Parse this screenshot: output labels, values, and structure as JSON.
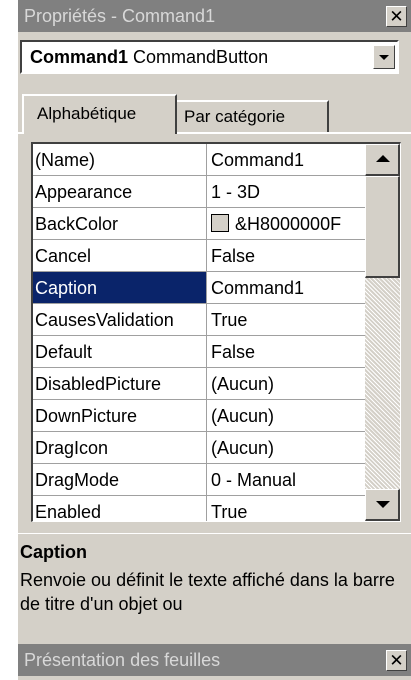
{
  "window": {
    "title": "Propriétés - Command1",
    "close_glyph": "✕"
  },
  "object_selector": {
    "name": "Command1",
    "type": "CommandButton"
  },
  "tabs": [
    {
      "label": "Alphabétique",
      "active": true
    },
    {
      "label": "Par catégorie",
      "active": false
    }
  ],
  "properties": [
    {
      "name": "(Name)",
      "value": "Command1"
    },
    {
      "name": "Appearance",
      "value": "1 - 3D"
    },
    {
      "name": "BackColor",
      "value": "&H8000000F",
      "swatch": "#d4d0c8"
    },
    {
      "name": "Cancel",
      "value": "False"
    },
    {
      "name": "Caption",
      "value": "Command1",
      "selected": true
    },
    {
      "name": "CausesValidation",
      "value": "True"
    },
    {
      "name": "Default",
      "value": "False"
    },
    {
      "name": "DisabledPicture",
      "value": "(Aucun)"
    },
    {
      "name": "DownPicture",
      "value": "(Aucun)"
    },
    {
      "name": "DragIcon",
      "value": "(Aucun)"
    },
    {
      "name": "DragMode",
      "value": "0 - Manual"
    },
    {
      "name": "Enabled",
      "value": "True"
    }
  ],
  "description": {
    "title": "Caption",
    "text": "Renvoie ou définit le texte affiché dans la barre de titre d'un objet ou"
  },
  "layout_window": {
    "title": "Présentation des feuilles",
    "close_glyph": "✕"
  },
  "colors": {
    "selection": "#0a246a",
    "face": "#d4d0c8",
    "inactive_title": "#808080"
  }
}
